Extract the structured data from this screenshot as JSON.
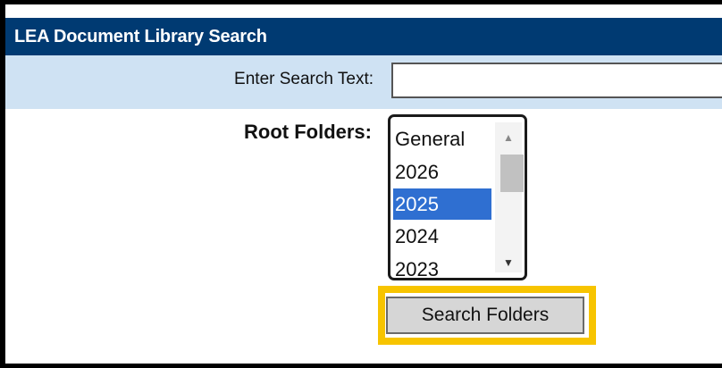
{
  "header": {
    "title": "LEA Document Library Search"
  },
  "search": {
    "label": "Enter Search Text:",
    "value": "",
    "placeholder": ""
  },
  "root_folders": {
    "label": "Root Folders:",
    "options": [
      "General",
      "2026",
      "2025",
      "2024",
      "2023"
    ],
    "selected": "2025"
  },
  "actions": {
    "search_button_label": "Search Folders"
  },
  "colors": {
    "header_bg": "#003a72",
    "search_row_bg": "#cfe2f3",
    "selected_item_bg": "#2f6fd1",
    "highlight_border": "#f7c400"
  },
  "icons": {
    "scroll_up": "triangle-up-icon",
    "scroll_down": "triangle-down-icon"
  }
}
